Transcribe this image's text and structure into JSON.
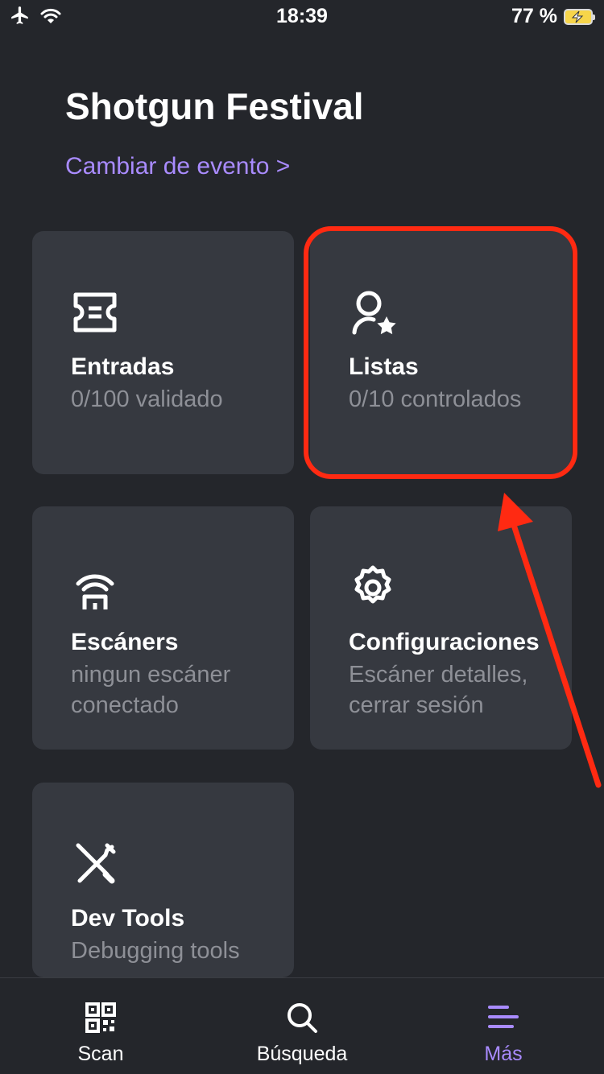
{
  "status_bar": {
    "time": "18:39",
    "battery": "77 %",
    "icons": [
      "airplane-icon",
      "wifi-icon",
      "battery-charging-icon"
    ]
  },
  "header": {
    "event_title": "Shotgun Festival",
    "change_event": "Cambiar de evento >"
  },
  "tiles": [
    {
      "icon": "ticket-icon",
      "title": "Entradas",
      "subtitle": "0/100 validado"
    },
    {
      "icon": "person-star-icon",
      "title": "Listas",
      "subtitle": "0/10 controlados"
    },
    {
      "icon": "scanner-wifi-icon",
      "title": "Escáners",
      "subtitle": "ningun escáner conectado"
    },
    {
      "icon": "gear-icon",
      "title": "Configuraciones",
      "subtitle": "Escáner detalles, cerrar sesión"
    },
    {
      "icon": "tools-icon",
      "title": "Dev Tools",
      "subtitle": "Debugging tools"
    }
  ],
  "annotation": {
    "highlight_color": "#ff2a12"
  },
  "bottom_nav": {
    "items": [
      {
        "label": "Scan",
        "icon": "qr-code-icon"
      },
      {
        "label": "Búsqueda",
        "icon": "search-icon"
      },
      {
        "label": "Más",
        "icon": "menu-icon",
        "active": true
      }
    ]
  },
  "colors": {
    "background": "#24262b",
    "tile": "#363940",
    "accent": "#a98bff",
    "subtitle": "#8e9097"
  }
}
